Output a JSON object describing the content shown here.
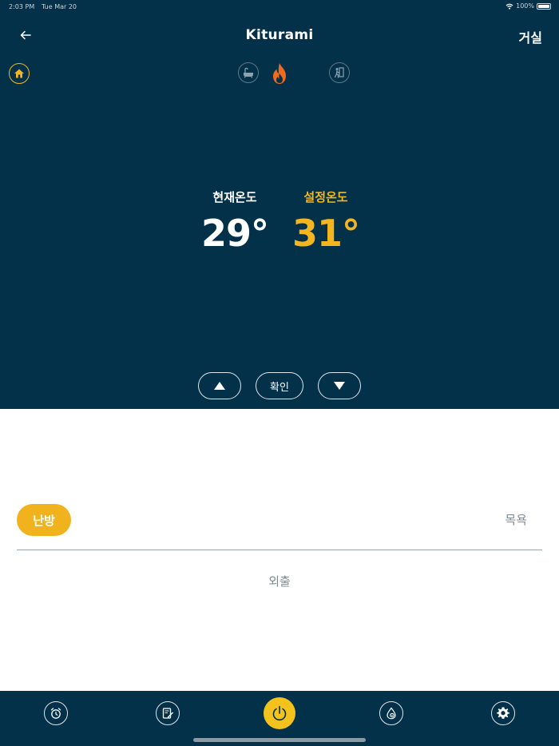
{
  "status_bar": {
    "time": "2:03 PM",
    "date": "Tue Mar 20",
    "battery": "100%"
  },
  "header": {
    "logo": "Kiturami",
    "room": "거실"
  },
  "temperature": {
    "current_label": "현재온도",
    "current_value": "29°",
    "set_label": "설정온도",
    "set_value": "31°"
  },
  "controls": {
    "up_icon": "triangle-up-icon",
    "confirm_label": "확인",
    "down_icon": "triangle-down-icon"
  },
  "modes": {
    "heating": "난방",
    "bath": "목욕",
    "away": "외출"
  },
  "icons": {
    "home": "home-icon",
    "bath": "bathtub-icon",
    "flame": "flame-icon",
    "away": "outing-icon",
    "alarm": "alarm-clock-icon",
    "schedule": "notepad-icon",
    "power": "power-icon",
    "water": "water-settings-icon",
    "settings": "gear-icon"
  },
  "colors": {
    "panel": "#04314a",
    "accent": "#f3b61f",
    "flame": "#f26a1b",
    "muted_text": "#7f8c94"
  }
}
